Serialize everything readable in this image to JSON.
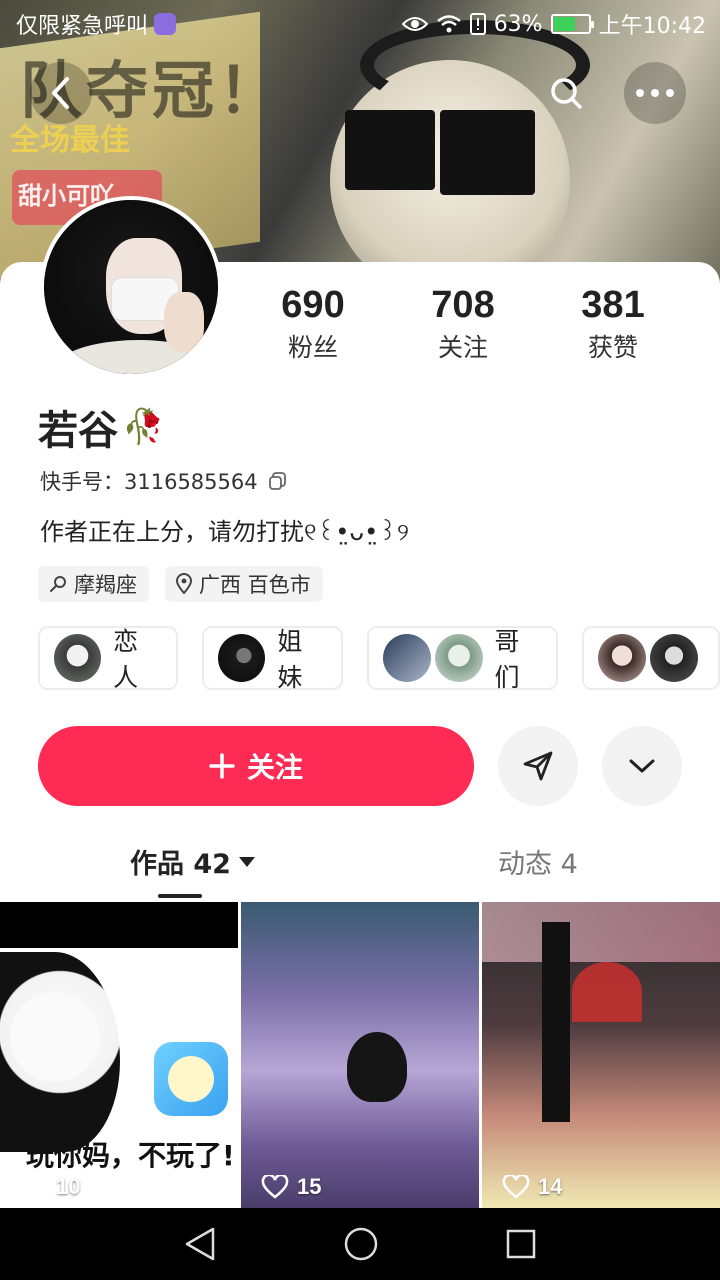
{
  "status_bar": {
    "carrier": "仅限紧急呼叫",
    "battery": "63%",
    "time": "上午10:42"
  },
  "banner": {
    "text_top": "队夺冠！",
    "text_mid": "全场最佳",
    "text_low": "甜小可吖"
  },
  "profile": {
    "name": "若谷",
    "name_emoji": "🥀",
    "id_label": "快手号：",
    "id_value": "3116585564",
    "bio": "作者正在上分，请勿打扰୧꒰•̤ᴗ•̤꒱୨",
    "tags": [
      {
        "icon": "search-tag-icon",
        "text": "摩羯座"
      },
      {
        "icon": "location-icon",
        "text": "广西 百色市"
      }
    ]
  },
  "stats": [
    {
      "value": "690",
      "label": "粉丝"
    },
    {
      "value": "708",
      "label": "关注"
    },
    {
      "value": "381",
      "label": "获赞"
    }
  ],
  "relations": [
    {
      "label": "恋人"
    },
    {
      "label": "姐妹"
    },
    {
      "label": "哥们"
    },
    {
      "label": ""
    }
  ],
  "actions": {
    "follow_label": "关注"
  },
  "tabs": {
    "works": "作品 42",
    "moments": "动态 4"
  },
  "videos": [
    {
      "likes": "10",
      "caption": "玩你妈，不玩了!"
    },
    {
      "likes": "15"
    },
    {
      "likes": "14"
    }
  ],
  "colors": {
    "accent": "#fe2c55",
    "text": "#222222"
  }
}
